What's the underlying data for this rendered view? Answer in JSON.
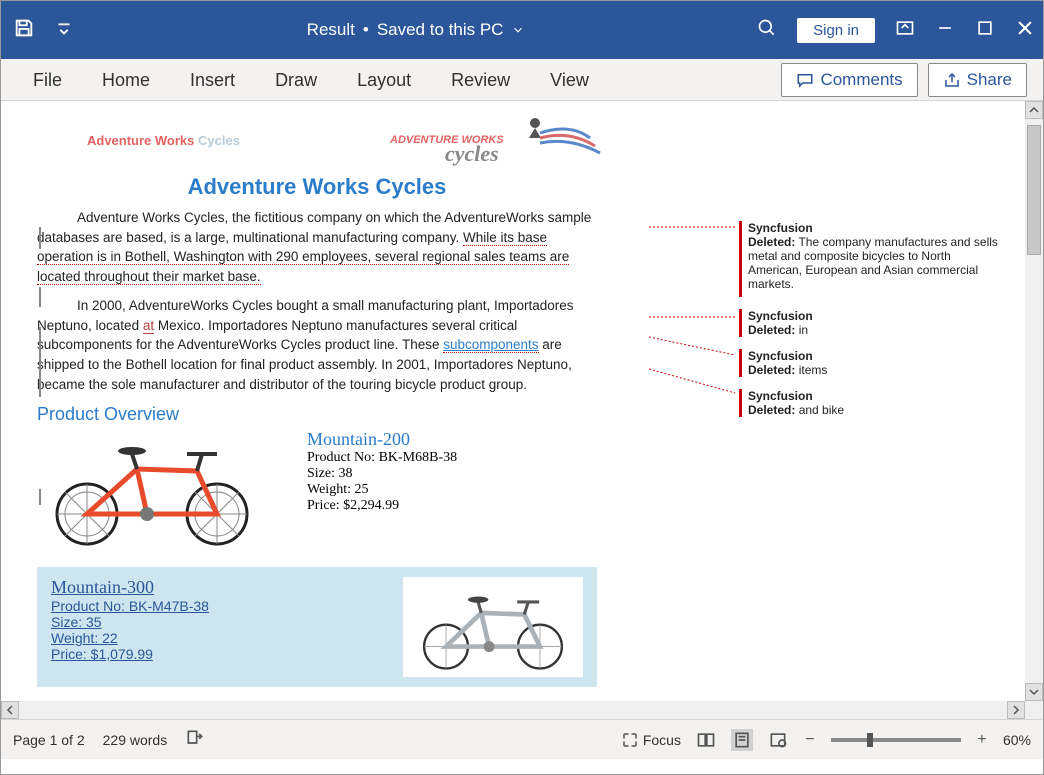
{
  "title": {
    "doc_name": "Result",
    "save_state": "Saved to this PC"
  },
  "signin": "Sign in",
  "menus": {
    "file": "File",
    "home": "Home",
    "insert": "Insert",
    "draw": "Draw",
    "layout": "Layout",
    "review": "Review",
    "view": "View"
  },
  "ribbon_buttons": {
    "comments": "Comments",
    "share": "Share"
  },
  "document": {
    "brand_prefix": "Adventure Works ",
    "brand_suffix": "Cycles",
    "main_title": "Adventure Works Cycles",
    "para1_prefix": "Adventure Works Cycles, the fictitious company on which the AdventureWorks sample databases are based, is a large, multinational manufacturing company. ",
    "para1_tracked": "While its base operation is in Bothell, Washington with 290 employees, several regional sales teams are located throughout their market base.",
    "para2_a": "In 2000, AdventureWorks Cycles bought a small manufacturing plant, Importadores Neptuno, located ",
    "para2_ins": "at",
    "para2_b": " Mexico. Importadores Neptuno manufactures several critical subcomponents for the AdventureWorks Cycles product line. These ",
    "para2_sub": "subcomponents",
    "para2_c": " are shipped to the Bothell location for final product assembly. In 2001, Importadores Neptuno, became the sole manufacturer and distributor of the touring bicycle product group.",
    "section": "Product Overview",
    "products": [
      {
        "name": "Mountain-200",
        "productno_label": "Product No:",
        "productno": "BK-M68B-38",
        "size_label": "Size:",
        "size": "38",
        "weight_label": "Weight:",
        "weight": "25",
        "price_label": "Price:",
        "price": "$2,294.99"
      },
      {
        "name": "Mountain-300",
        "productno_full": "Product No: BK-M47B-38",
        "size_full": "Size: 35",
        "weight_full": "Weight: 22",
        "price_full": "Price: $1,079.99"
      }
    ]
  },
  "balloons": [
    {
      "user": "Syncfusion",
      "label": "Deleted:",
      "text": "The company manufactures and sells metal and composite bicycles to North American, European and Asian commercial markets."
    },
    {
      "user": "Syncfusion",
      "label": "Deleted:",
      "text": "in"
    },
    {
      "user": "Syncfusion",
      "label": "Deleted:",
      "text": "items"
    },
    {
      "user": "Syncfusion",
      "label": "Deleted:",
      "text": "and bike"
    }
  ],
  "status": {
    "page": "Page 1 of 2",
    "words": "229 words",
    "focus": "Focus",
    "zoom": "60%"
  }
}
